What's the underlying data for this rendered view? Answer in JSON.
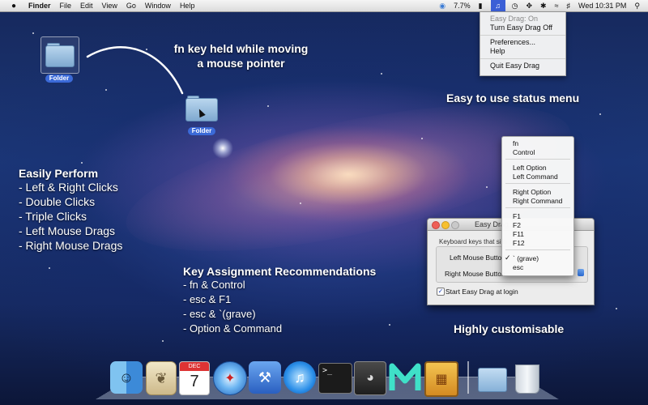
{
  "menubar": {
    "app_name": "Finder",
    "items": [
      "File",
      "Edit",
      "View",
      "Go",
      "Window",
      "Help"
    ],
    "battery": "7.7%",
    "clock": "Wed 10:31 PM"
  },
  "status_menu": {
    "status_line": "Easy Drag: On",
    "toggle": "Turn Easy Drag Off",
    "preferences": "Preferences...",
    "help": "Help",
    "quit": "Quit Easy Drag"
  },
  "folders": {
    "source_label": "Folder",
    "target_label": "Folder"
  },
  "captions": {
    "fn_line1": "fn key held while moving",
    "fn_line2": "a mouse pointer",
    "status_menu": "Easy to use status menu",
    "customisable": "Highly customisable"
  },
  "features": {
    "heading": "Easily Perform",
    "items": [
      "- Left & Right Clicks",
      "- Double Clicks",
      "- Triple Clicks",
      "- Left Mouse Drags",
      "- Right Mouse Drags"
    ]
  },
  "recommendations": {
    "heading": "Key Assignment Recommendations",
    "items": [
      "- fn & Control",
      "- esc & F1",
      "- esc & `(grave)",
      "- Option & Command"
    ]
  },
  "prefs_window": {
    "title": "Easy Drag",
    "description": "Keyboard keys that sim",
    "left_label": "Left Mouse Button",
    "right_label": "Right Mouse Button",
    "start_at_login": "Start Easy Drag at login",
    "start_at_login_checked": true
  },
  "key_list": {
    "group1": [
      "fn",
      "Control"
    ],
    "group2": [
      "Left Option",
      "Left Command"
    ],
    "group3": [
      "Right Option",
      "Right Command"
    ],
    "group4": [
      "F1",
      "F2",
      "F11",
      "F12"
    ],
    "group5": [
      "` (grave)",
      "esc"
    ],
    "selected": "` (grave)",
    "check_mark": "✓"
  },
  "dock": {
    "calendar_month": "DEC",
    "calendar_day": "7"
  },
  "colors": {
    "selection_blue": "#3b6ad8",
    "menubar_bg": "#e8e8e8",
    "desktop_blue": "#1c3878"
  }
}
